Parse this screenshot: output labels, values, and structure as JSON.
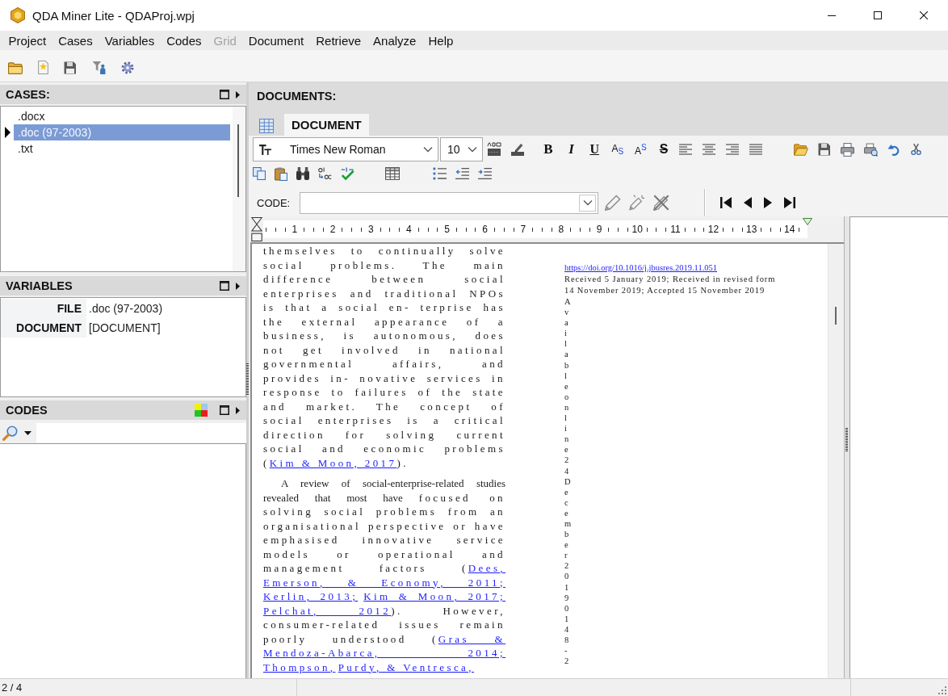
{
  "window": {
    "title": "QDA Miner Lite - QDAProj.wpj"
  },
  "menu": [
    {
      "label": "Project",
      "disabled": false
    },
    {
      "label": "Cases",
      "disabled": false
    },
    {
      "label": "Variables",
      "disabled": false
    },
    {
      "label": "Codes",
      "disabled": false
    },
    {
      "label": "Grid",
      "disabled": true
    },
    {
      "label": "Document",
      "disabled": false
    },
    {
      "label": "Retrieve",
      "disabled": false
    },
    {
      "label": "Analyze",
      "disabled": false
    },
    {
      "label": "Help",
      "disabled": false
    }
  ],
  "cases": {
    "title": "CASES:",
    "items": [
      {
        "label": ".docx",
        "selected": false
      },
      {
        "label": ".doc (97-2003)",
        "selected": true
      },
      {
        "label": ".txt",
        "selected": false
      }
    ]
  },
  "variables": {
    "title": "VARIABLES",
    "rows": [
      {
        "name": "FILE",
        "value": ".doc (97-2003)"
      },
      {
        "name": "DOCUMENT",
        "value": "[DOCUMENT]"
      }
    ]
  },
  "codes": {
    "title": "CODES"
  },
  "documents": {
    "title": "DOCUMENTS:",
    "tabs": [
      {
        "label": "DOCUMENT",
        "selected": true
      }
    ],
    "font": {
      "name": "Times New Roman",
      "size": "10"
    },
    "format_buttons": [
      {
        "kind": "bold",
        "label": "B"
      },
      {
        "kind": "italic",
        "label": "I"
      },
      {
        "kind": "underline",
        "label": "U"
      },
      {
        "kind": "subscript",
        "label": "A$_{S}$"
      },
      {
        "kind": "superscript",
        "label": "A$^{S}$"
      },
      {
        "kind": "strike",
        "label": "S"
      }
    ],
    "code_label": "CODE:",
    "ruler": [
      "1",
      "2",
      "3",
      "4",
      "5",
      "6",
      "7",
      "8",
      "9",
      "10",
      "11",
      "12",
      "13",
      "14"
    ],
    "left_column": [
      {
        "lines": [
          [
            {
              "kind": "text",
              "text": "themselves to continually solve"
            }
          ],
          [
            {
              "kind": "text",
              "text": "social problems. The main"
            }
          ],
          [
            {
              "kind": "text",
              "text": "difference between social"
            }
          ],
          [
            {
              "kind": "text",
              "text": "enterprises and traditional NPOs"
            }
          ],
          [
            {
              "kind": "text",
              "text": "is that a social en- terprise has"
            }
          ],
          [
            {
              "kind": "text",
              "text": "the external appearance of a"
            }
          ],
          [
            {
              "kind": "text",
              "text": "business, is autonomous, does"
            }
          ],
          [
            {
              "kind": "text",
              "text": "not get involved in national"
            }
          ],
          [
            {
              "kind": "text",
              "text": "governmental affairs, and"
            }
          ],
          [
            {
              "kind": "text",
              "text": "provides in- novative services in"
            }
          ],
          [
            {
              "kind": "text",
              "text": "response to failures of the state"
            }
          ],
          [
            {
              "kind": "text",
              "text": "and market. The concept of"
            }
          ],
          [
            {
              "kind": "text",
              "text": "social enterprises is a critical"
            }
          ],
          [
            {
              "kind": "text",
              "text": "direction for solving current"
            }
          ],
          [
            {
              "kind": "text",
              "text": "social and economic problems"
            }
          ],
          [
            {
              "kind": "text",
              "text": "("
            },
            {
              "kind": "link",
              "text": "Kim & Moon, 2017"
            },
            {
              "kind": "text",
              "text": ")."
            }
          ]
        ]
      },
      {
        "lines": [
          [
            {
              "kind": "tight",
              "text": "A review of social-enterprise-related studies"
            }
          ],
          [
            {
              "kind": "tight",
              "text": "revealed that most have "
            },
            {
              "kind": "text",
              "text": "focused on"
            }
          ],
          [
            {
              "kind": "text",
              "text": "solving social problems from an"
            }
          ],
          [
            {
              "kind": "text",
              "text": "organisational perspective or have"
            }
          ],
          [
            {
              "kind": "text",
              "text": "emphasised innovative service"
            }
          ],
          [
            {
              "kind": "text",
              "text": "models or operational and"
            }
          ],
          [
            {
              "kind": "text",
              "text": "management factors ("
            },
            {
              "kind": "link",
              "text": "Dees,"
            }
          ],
          [
            {
              "kind": "link",
              "text": "Emerson, & Economy, 2011;"
            }
          ],
          [
            {
              "kind": "link",
              "text": "Kerlin, 2013;"
            },
            {
              "kind": "link",
              "text": "Kim & Moon, 2017;"
            }
          ],
          [
            {
              "kind": "link",
              "text": "Pelchat, 2012"
            },
            {
              "kind": "text",
              "text": "). However,"
            }
          ],
          [
            {
              "kind": "text",
              "text": "consumer-related issues remain"
            }
          ],
          [
            {
              "kind": "text",
              "text": "poorly understood ("
            },
            {
              "kind": "link",
              "text": "Gras &"
            }
          ],
          [
            {
              "kind": "link",
              "text": "Mendoza-Abarca, 2014;"
            }
          ],
          [
            {
              "kind": "link",
              "text": "Thompson,"
            },
            {
              "kind": "link",
              "text": "Purdy, & Ventresca,"
            }
          ]
        ]
      }
    ],
    "right_column": [
      {
        "kind": "link",
        "text": "https://doi.org/10.1016/j.jbusres.2019.11.051"
      },
      {
        "kind": "text",
        "lines": [
          "Received 5 January 2019; Received in revised form",
          "14 November 2019; Accepted 15 November 2019"
        ]
      },
      {
        "kind": "vertical",
        "text": "Availableonline24December20190148-2"
      }
    ]
  },
  "status_bar": {
    "position": "2 / 4"
  }
}
